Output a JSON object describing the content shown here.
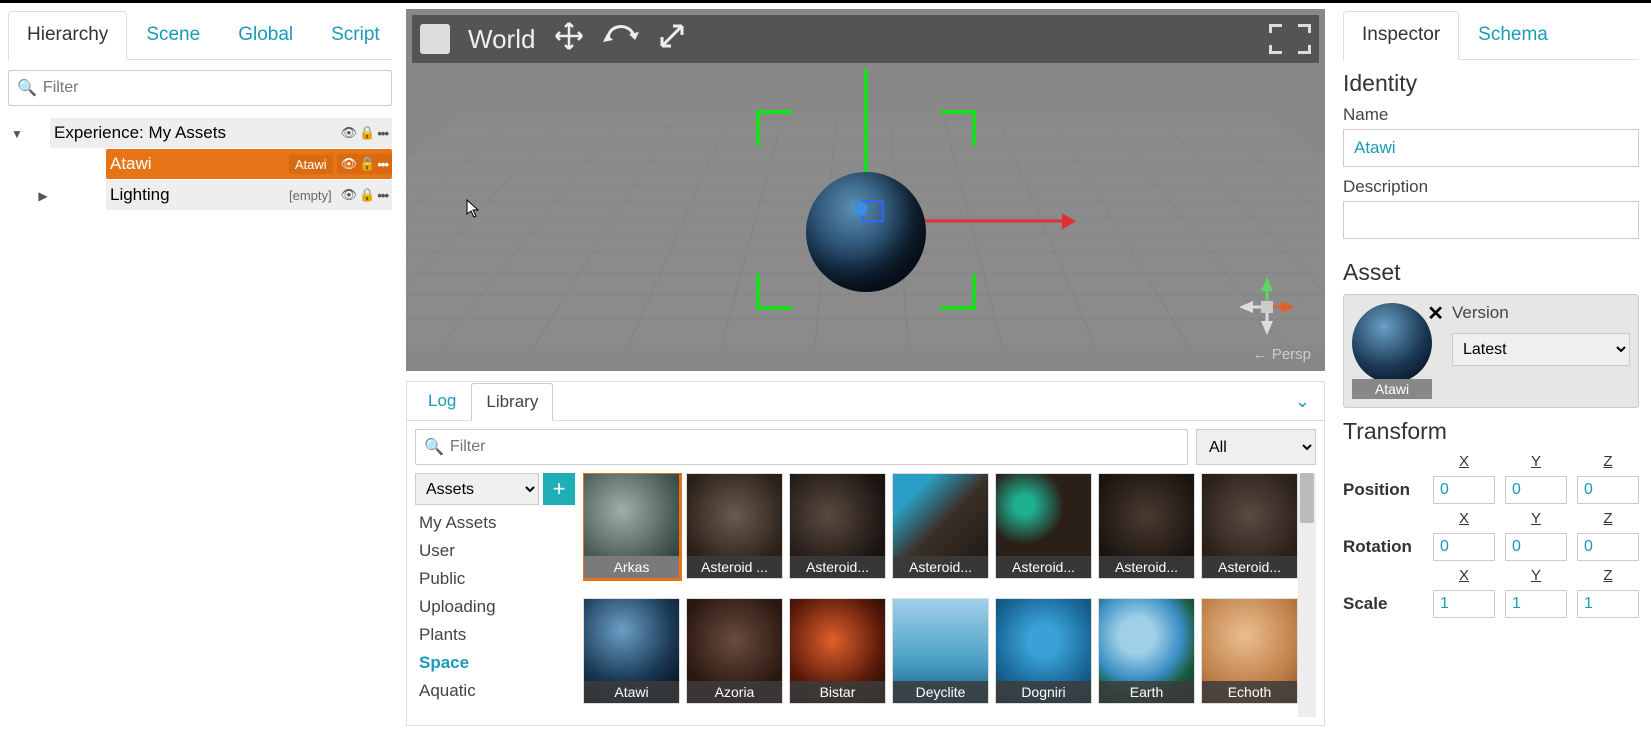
{
  "left": {
    "tabs": [
      "Hierarchy",
      "Scene",
      "Global",
      "Script"
    ],
    "active_tab": 0,
    "filter_placeholder": "Filter",
    "root_label": "Experience: My Assets",
    "items": [
      {
        "label": "Atawi",
        "badge": "Atawi",
        "selected": true,
        "has_children": false
      },
      {
        "label": "Lighting",
        "badge": "[empty]",
        "selected": false,
        "has_children": true
      }
    ]
  },
  "viewport": {
    "toolbar_label": "World",
    "persp_label": "← Persp",
    "axes": {
      "x": "X",
      "y": "Y",
      "z": "Z"
    }
  },
  "bottom": {
    "tabs": [
      "Log",
      "Library"
    ],
    "active_tab": 1,
    "filter_placeholder": "Filter",
    "type_filter": "All",
    "asset_source": "Assets",
    "categories": [
      "My Assets",
      "User",
      "Public",
      "Uploading",
      "Plants",
      "Space",
      "Aquatic"
    ],
    "active_category": 5,
    "assets_row1": [
      "Arkas",
      "Asteroid ...",
      "Asteroid...",
      "Asteroid...",
      "Asteroid...",
      "Asteroid...",
      "Asteroid..."
    ],
    "assets_row2": [
      "Atawi",
      "Azoria",
      "Bistar",
      "Deyclite",
      "Dogniri",
      "Earth",
      "Echoth"
    ],
    "selected_asset": "Arkas"
  },
  "inspector": {
    "tabs": [
      "Inspector",
      "Schema"
    ],
    "active_tab": 0,
    "identity_heading": "Identity",
    "name_label": "Name",
    "name_value": "Atawi",
    "desc_label": "Description",
    "desc_value": "",
    "asset_heading": "Asset",
    "asset_thumb_label": "Atawi",
    "version_label": "Version",
    "version_value": "Latest",
    "transform_heading": "Transform",
    "axis_labels": [
      "X",
      "Y",
      "Z"
    ],
    "rows": {
      "position": {
        "label": "Position",
        "x": "0",
        "y": "0",
        "z": "0"
      },
      "rotation": {
        "label": "Rotation",
        "x": "0",
        "y": "0",
        "z": "0"
      },
      "scale": {
        "label": "Scale",
        "x": "1",
        "y": "1",
        "z": "1"
      }
    }
  }
}
